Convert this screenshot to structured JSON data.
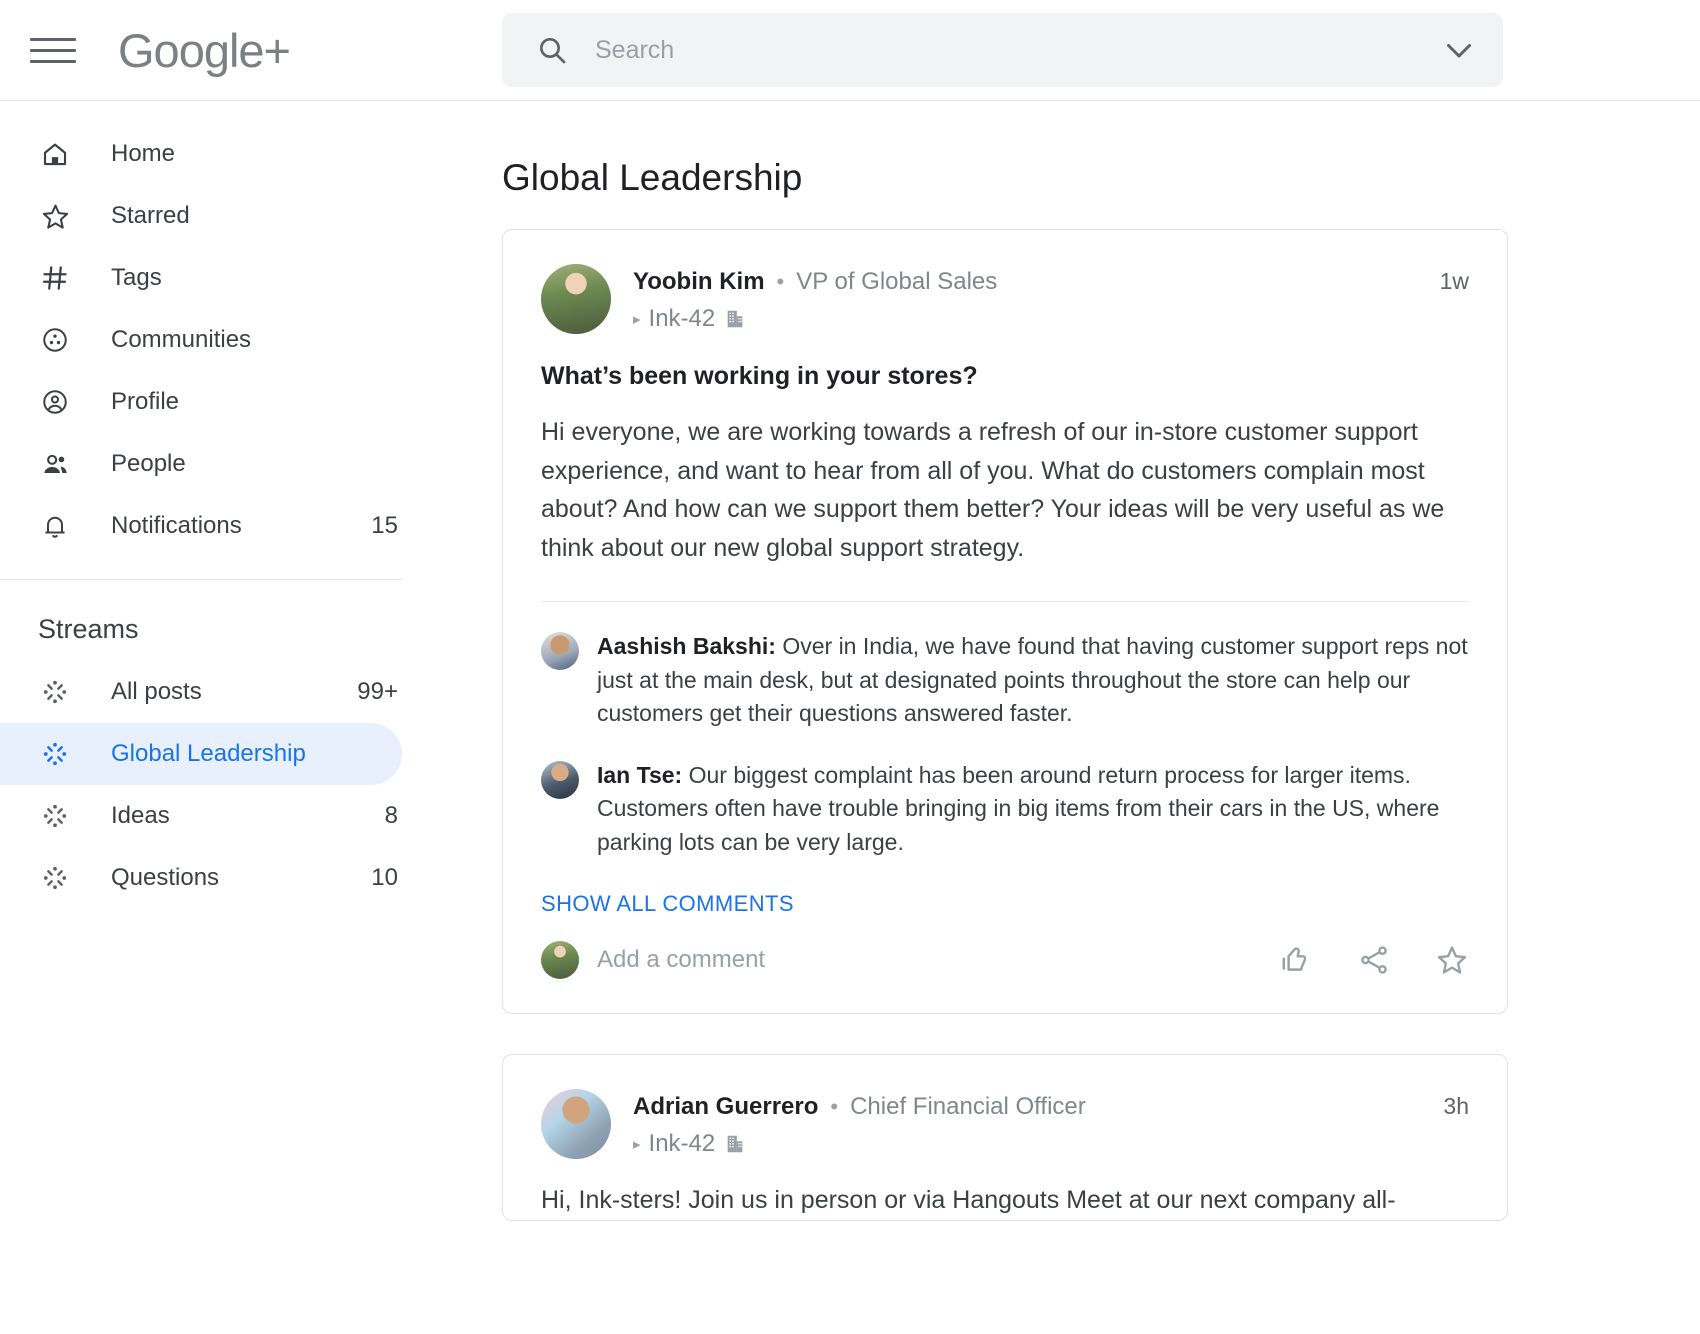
{
  "header": {
    "menu_icon": "hamburger-menu-icon",
    "logo_text": "Google+",
    "search": {
      "placeholder": "Search",
      "value": "",
      "icon": "search-icon",
      "expand_icon": "chevron-down-icon"
    }
  },
  "sidebar": {
    "nav_items": [
      {
        "label": "Home",
        "icon": "home-icon",
        "count": ""
      },
      {
        "label": "Starred",
        "icon": "star-icon",
        "count": ""
      },
      {
        "label": "Tags",
        "icon": "hash-icon",
        "count": ""
      },
      {
        "label": "Communities",
        "icon": "communities-icon",
        "count": ""
      },
      {
        "label": "Profile",
        "icon": "profile-icon",
        "count": ""
      },
      {
        "label": "People",
        "icon": "people-icon",
        "count": ""
      },
      {
        "label": "Notifications",
        "icon": "bell-icon",
        "count": "15"
      }
    ],
    "streams_header": "Streams",
    "streams": [
      {
        "label": "All posts",
        "icon": "stream-burst-icon",
        "count": "99+",
        "active": false
      },
      {
        "label": "Global Leadership",
        "icon": "stream-burst-icon",
        "count": "",
        "active": true
      },
      {
        "label": "Ideas",
        "icon": "stream-burst-icon",
        "count": "8",
        "active": false
      },
      {
        "label": "Questions",
        "icon": "stream-burst-icon",
        "count": "10",
        "active": false
      }
    ]
  },
  "main": {
    "page_title": "Global Leadership",
    "posts": [
      {
        "author": "Yoobin Kim",
        "separator": "•",
        "role": "VP of Global Sales",
        "company": "Ink-42",
        "timestamp": "1w",
        "title": "What’s been working in your stores?",
        "body": "Hi everyone, we are working towards a refresh of our in-store customer support experience, and want to hear from all of you. What do customers complain most about? And how can we support them better? Your ideas will be very useful as we think about our new global support strategy.",
        "comments": [
          {
            "author": "Aashish Bakshi:",
            "text": " Over in India, we have found that having customer support reps not just at the main desk, but at designated points throughout the store can help our customers get their questions answered faster."
          },
          {
            "author": "Ian Tse:",
            "text": " Our biggest complaint has been around return process for larger items. Customers often have trouble bringing in big items from their cars in the US, where parking lots can be very large."
          }
        ],
        "show_all_comments": "SHOW ALL COMMENTS",
        "add_comment_placeholder": "Add a comment",
        "actions": [
          {
            "name": "like-icon"
          },
          {
            "name": "share-icon"
          },
          {
            "name": "star-icon"
          }
        ]
      },
      {
        "author": "Adrian Guerrero",
        "separator": "•",
        "role": "Chief Financial Officer",
        "company": "Ink-42",
        "timestamp": "3h",
        "title": "",
        "body": "Hi, Ink-sters! Join us in person or via Hangouts Meet at our next company all-",
        "comments": [],
        "show_all_comments": "",
        "add_comment_placeholder": "",
        "actions": []
      }
    ]
  },
  "colors": {
    "accent_blue": "#1a73e8",
    "active_pill": "#e8f0fe",
    "text_primary": "#202124",
    "text_secondary": "#80868b",
    "search_bg": "#f1f3f4",
    "border": "#dfe1e5"
  }
}
